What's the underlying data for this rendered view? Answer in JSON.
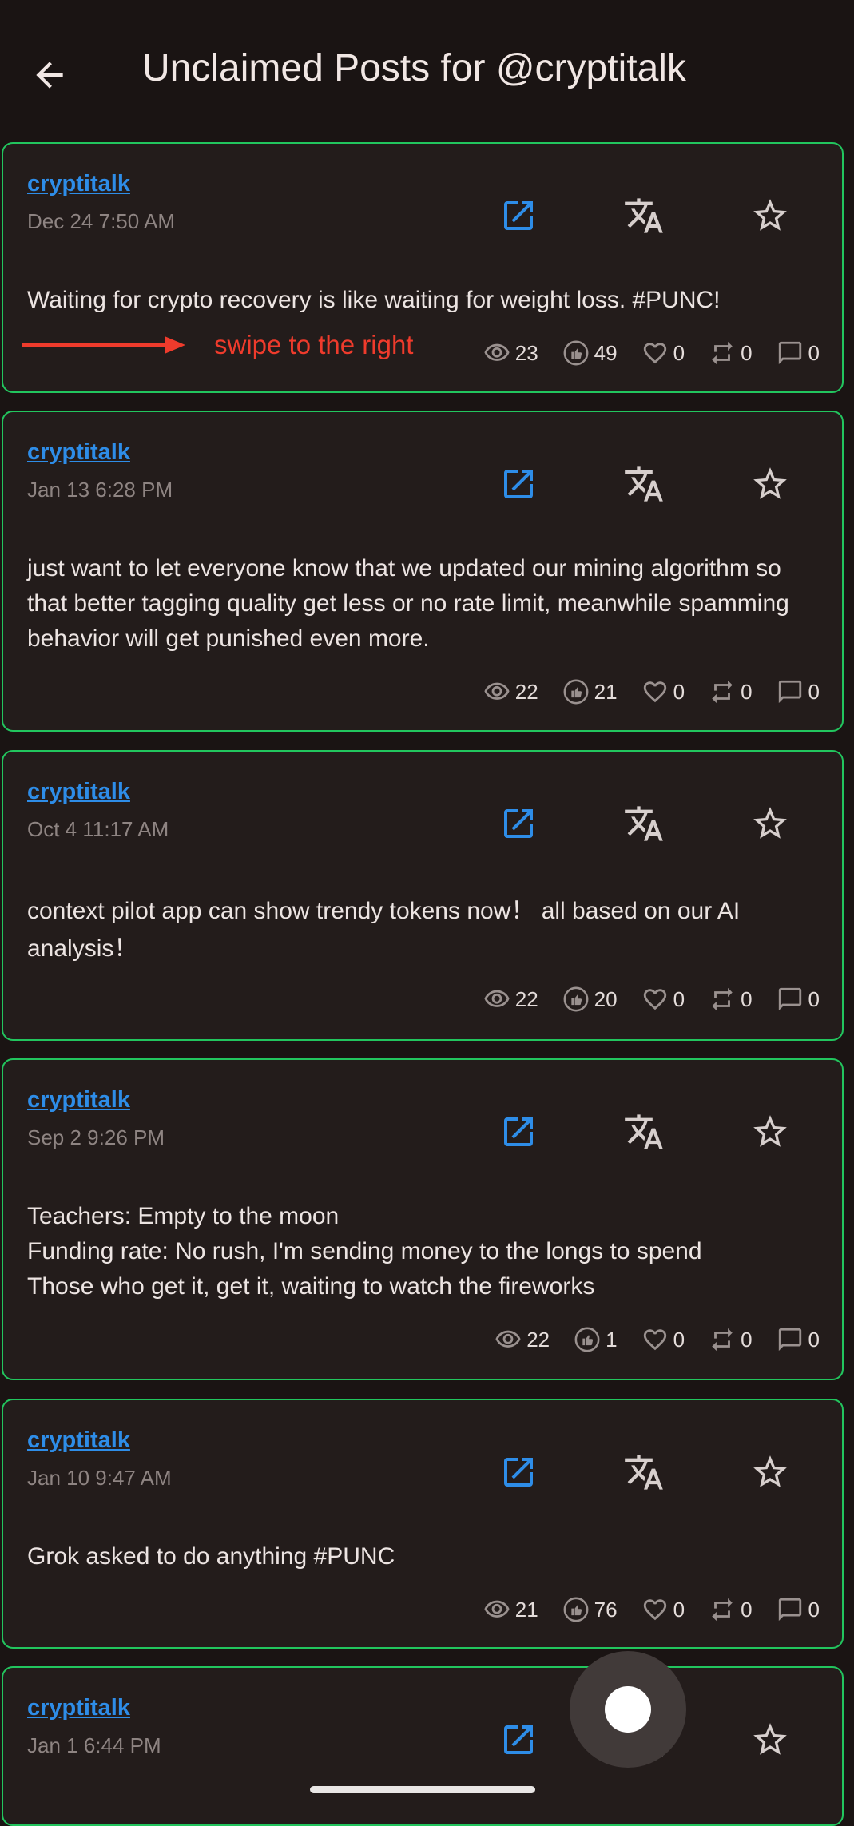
{
  "header": {
    "title": "Unclaimed Posts for @cryptitalk"
  },
  "annotation": {
    "swipe_label": "swipe to the right"
  },
  "icons": {
    "back": "arrow-left-icon",
    "open": "open-in-new-icon",
    "translate": "translate-icon",
    "star": "star-outline-icon",
    "views": "eye-icon",
    "thumbs": "thumbs-up-icon",
    "likes": "heart-icon",
    "reposts": "repost-icon",
    "comments": "comment-icon"
  },
  "colors": {
    "link": "#2e8de8",
    "card_border": "#22c55e",
    "annotation": "#ef3b2c"
  },
  "posts": [
    {
      "author": "cryptitalk",
      "date": "Dec 24 7:50 AM",
      "text": "Waiting for crypto recovery is like waiting for weight loss. #PUNC!",
      "views": "23",
      "thumbs": "49",
      "likes": "0",
      "reposts": "0",
      "comments": "0"
    },
    {
      "author": "cryptitalk",
      "date": "Jan 13 6:28 PM",
      "text": "just want to let everyone know that we updated our mining algorithm so that better tagging quality get less or no rate limit, meanwhile spamming behavior will get punished even more.",
      "views": "22",
      "thumbs": "21",
      "likes": "0",
      "reposts": "0",
      "comments": "0"
    },
    {
      "author": "cryptitalk",
      "date": "Oct 4 11:17 AM",
      "text": "context pilot app can show trendy tokens now！ all based on our AI analysis！",
      "views": "22",
      "thumbs": "20",
      "likes": "0",
      "reposts": "0",
      "comments": "0"
    },
    {
      "author": "cryptitalk",
      "date": "Sep 2 9:26 PM",
      "text": "Teachers: Empty to the moon\nFunding rate: No rush, I'm sending money to the longs to spend\nThose who get it, get it, waiting to watch the fireworks",
      "views": "22",
      "thumbs": "1",
      "likes": "0",
      "reposts": "0",
      "comments": "0"
    },
    {
      "author": "cryptitalk",
      "date": "Jan 10 9:47 AM",
      "text": "Grok asked to do anything #PUNC",
      "views": "21",
      "thumbs": "76",
      "likes": "0",
      "reposts": "0",
      "comments": "0"
    },
    {
      "author": "cryptitalk",
      "date": "Jan 1 6:44 PM"
    }
  ]
}
